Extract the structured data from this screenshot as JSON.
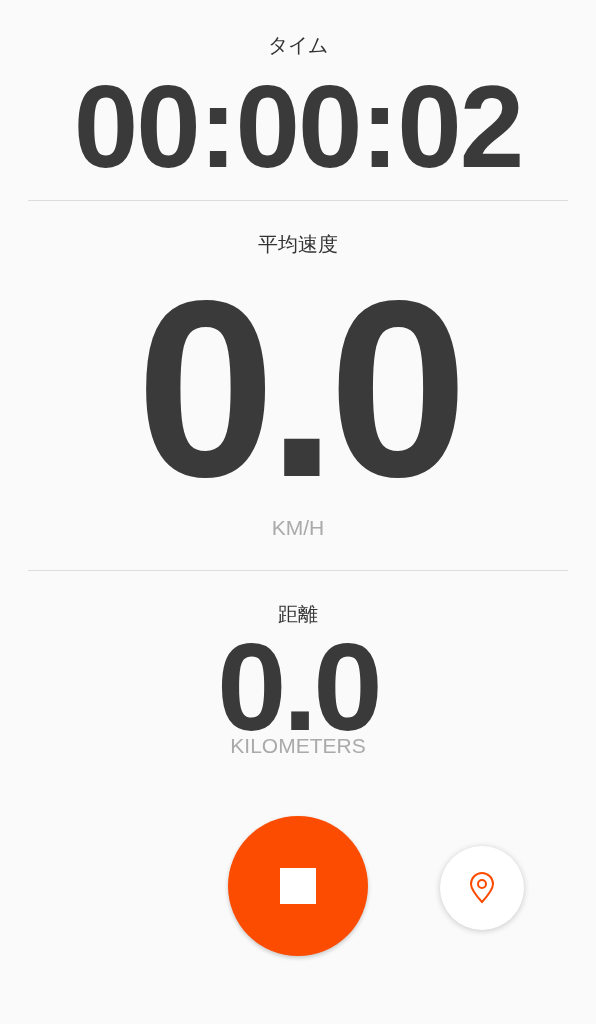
{
  "stats": [
    {
      "label": "タイム",
      "value": "00:00:02",
      "kind": "time"
    },
    {
      "label": "平均速度",
      "value": "0.0",
      "unit": "KM/H",
      "kind": "large"
    },
    {
      "label": "距離",
      "value": "0.0",
      "unit": "KILOMETERS",
      "kind": "medium"
    }
  ]
}
